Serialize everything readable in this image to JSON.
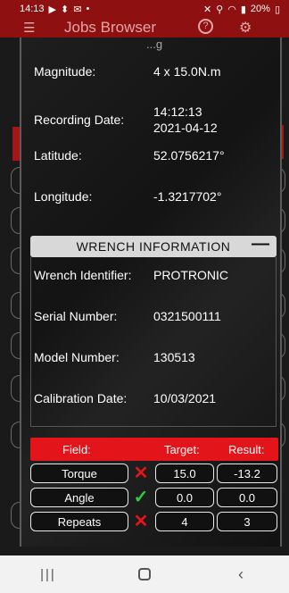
{
  "status_bar": {
    "time": "14:13",
    "battery": "20%",
    "left_icons": [
      "media-icon",
      "usb-icon",
      "mail-icon",
      "dot-icon"
    ],
    "right_icons": [
      "mute-icon",
      "location-icon",
      "wifi-icon",
      "signal-icon",
      "battery-icon"
    ]
  },
  "app_bar": {
    "title": "Jobs Browser",
    "help_label": "?",
    "menu_icon": "hamburger-icon",
    "settings_icon": "gear-icon"
  },
  "dialog": {
    "partial_top_text": "...g",
    "measurement": {
      "magnitude_label": "Magnitude:",
      "magnitude_value": "4 x 15.0N.m",
      "recording_date_label": "Recording Date:",
      "recording_time_value": "14:12:13",
      "recording_date_value": "2021-04-12",
      "latitude_label": "Latitude:",
      "latitude_value": "52.0756217°",
      "longitude_label": "Longitude:",
      "longitude_value": "-1.3217702°"
    },
    "wrench": {
      "header": "WRENCH INFORMATION",
      "collapse_label": "—",
      "identifier_label": "Wrench Identifier:",
      "identifier_value": "PROTRONIC",
      "serial_label": "Serial Number:",
      "serial_value": "0321500111",
      "model_label": "Model Number:",
      "model_value": "130513",
      "calibration_label": "Calibration Date:",
      "calibration_value": "10/03/2021"
    },
    "results": {
      "columns": [
        "Field:",
        "Target:",
        "Result:"
      ],
      "rows": [
        {
          "field": "Torque",
          "status": "fail",
          "target": "15.0",
          "result": "-13.2"
        },
        {
          "field": "Angle",
          "status": "pass",
          "target": "0.0",
          "result": "0.0"
        },
        {
          "field": "Repeats",
          "status": "fail",
          "target": "4",
          "result": "3"
        }
      ]
    }
  },
  "nav_bar": {
    "recents_icon": "recents-icon",
    "home_icon": "home-icon",
    "back_icon": "back-icon"
  },
  "colors": {
    "brand_red": "#e3151a",
    "appbar_red": "#8e1010",
    "pass_green": "#2ecc40",
    "fail_red": "#e3151a"
  }
}
